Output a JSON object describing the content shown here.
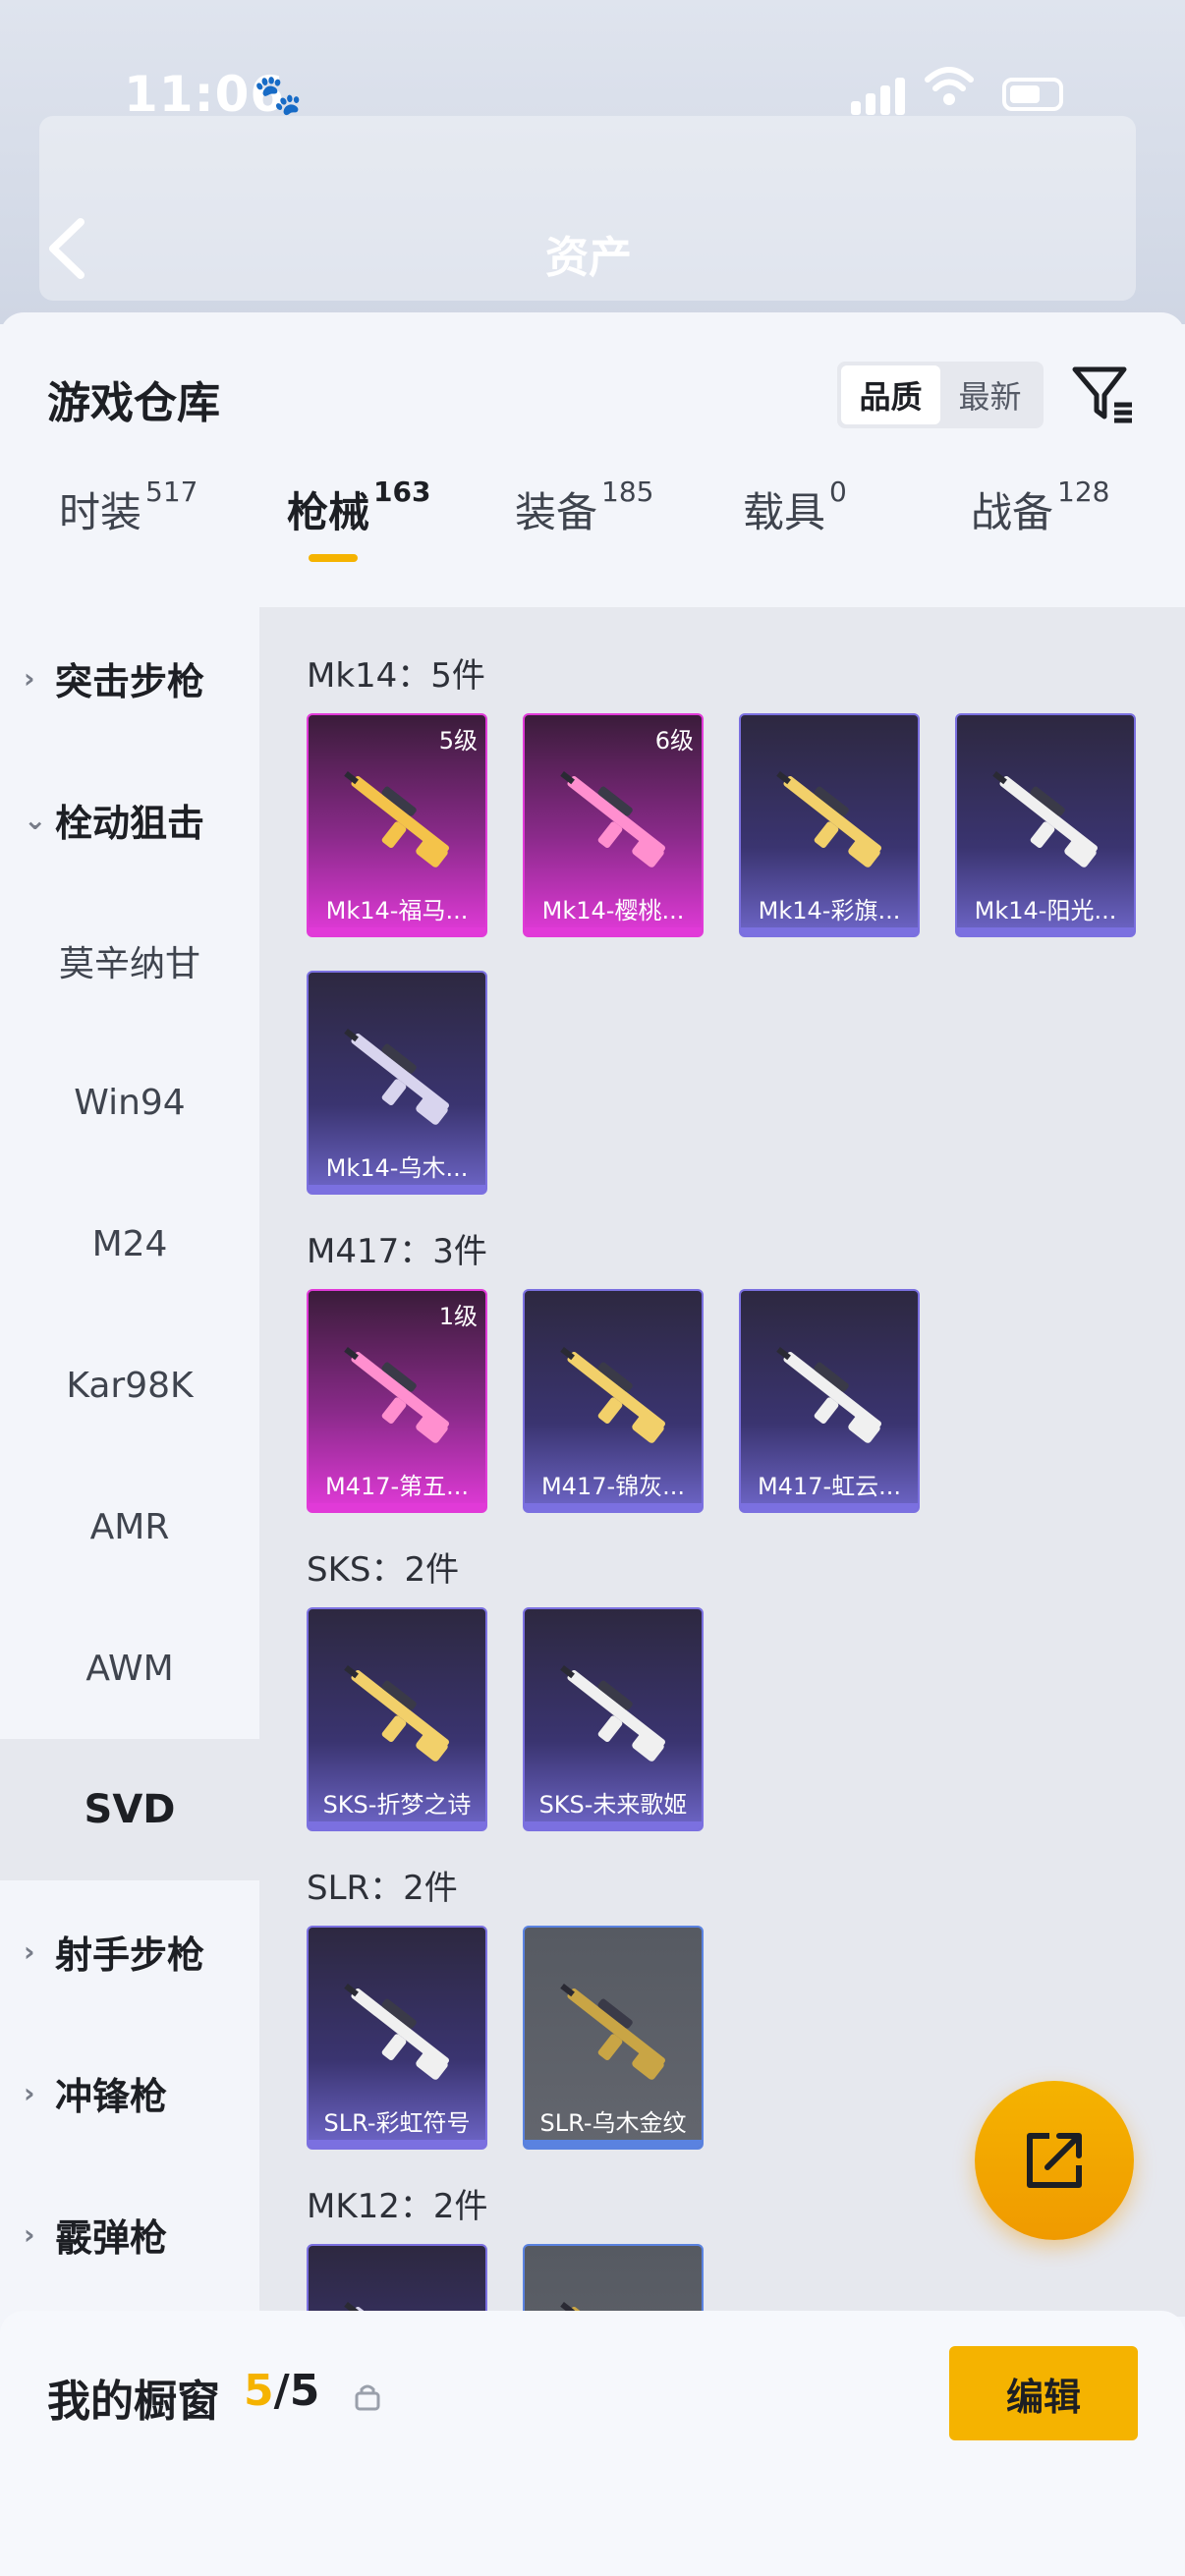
{
  "status": {
    "time": "11:06"
  },
  "header": {
    "asset_title": "资产"
  },
  "warehouse": {
    "title": "游戏仓库",
    "sort": {
      "options": [
        "品质",
        "最新"
      ],
      "selected": "品质"
    }
  },
  "tabs": [
    {
      "label": "时装",
      "count": "517"
    },
    {
      "label": "枪械",
      "count": "163",
      "active": true
    },
    {
      "label": "装备",
      "count": "185"
    },
    {
      "label": "载具",
      "count": "0"
    },
    {
      "label": "战备",
      "count": "128"
    }
  ],
  "categories": [
    {
      "label": "突击步枪",
      "type": "group",
      "expanded": false
    },
    {
      "label": "栓动狙击",
      "type": "group",
      "expanded": true
    },
    {
      "label": "莫辛纳甘",
      "type": "sub"
    },
    {
      "label": "Win94",
      "type": "sub"
    },
    {
      "label": "M24",
      "type": "sub"
    },
    {
      "label": "Kar98K",
      "type": "sub"
    },
    {
      "label": "AMR",
      "type": "sub"
    },
    {
      "label": "AWM",
      "type": "sub"
    },
    {
      "label": "SVD",
      "type": "sub",
      "selected": true
    },
    {
      "label": "射手步枪",
      "type": "group",
      "expanded": false
    },
    {
      "label": "冲锋枪",
      "type": "group",
      "expanded": false
    },
    {
      "label": "霰弹枪",
      "type": "group",
      "expanded": false
    }
  ],
  "groups": [
    {
      "header": "Mk14：5件",
      "items": [
        {
          "name": "Mk14-福马...",
          "level": "5级",
          "rarity": "pink"
        },
        {
          "name": "Mk14-樱桃...",
          "level": "6级",
          "rarity": "pink"
        },
        {
          "name": "Mk14-彩旗...",
          "level": "",
          "rarity": "purple"
        },
        {
          "name": "Mk14-阳光...",
          "level": "",
          "rarity": "purple"
        },
        {
          "name": "Mk14-乌木...",
          "level": "",
          "rarity": "purple"
        }
      ]
    },
    {
      "header": "M417：3件",
      "items": [
        {
          "name": "M417-第五...",
          "level": "1级",
          "rarity": "pink"
        },
        {
          "name": "M417-锦灰...",
          "level": "",
          "rarity": "purple"
        },
        {
          "name": "M417-虹云...",
          "level": "",
          "rarity": "purple"
        }
      ]
    },
    {
      "header": "SKS：2件",
      "items": [
        {
          "name": "SKS-折梦之诗",
          "level": "",
          "rarity": "purple"
        },
        {
          "name": "SKS-未来歌姬",
          "level": "",
          "rarity": "purple"
        }
      ]
    },
    {
      "header": "SLR：2件",
      "items": [
        {
          "name": "SLR-彩虹符号",
          "level": "",
          "rarity": "purple"
        },
        {
          "name": "SLR-乌木金纹",
          "level": "",
          "rarity": "gray"
        }
      ]
    },
    {
      "header": "MK12：2件",
      "items": [
        {
          "name": "",
          "level": "",
          "rarity": "purple"
        },
        {
          "name": "",
          "level": "",
          "rarity": "gray"
        }
      ]
    }
  ],
  "showcase": {
    "label": "我的橱窗",
    "count": "5",
    "total": "/5",
    "edit_label": "编辑"
  },
  "colors": {
    "accent": "#f5b300",
    "purple": "#7b70e0",
    "pink": "#e13ad8"
  }
}
